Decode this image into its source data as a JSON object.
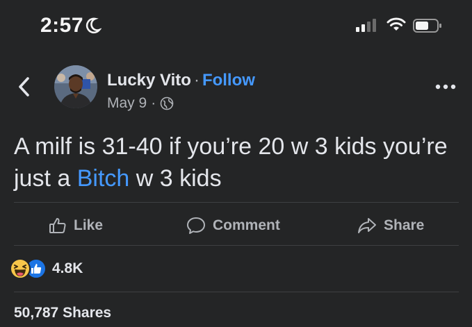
{
  "status_bar": {
    "time": "2:57",
    "icons": [
      "moon-icon",
      "signal-icon",
      "wifi-icon",
      "battery-icon"
    ]
  },
  "header": {
    "author": "Lucky Vito",
    "separator": "·",
    "follow_label": "Follow",
    "date": "May 9",
    "date_separator": "·",
    "privacy_icon": "globe-icon"
  },
  "post": {
    "text_before_link": "A milf is 31-40 if you’re 20 w 3 kids you’re just a ",
    "link_text": "Bitch",
    "text_after_link": " w 3 kids"
  },
  "actions": {
    "like_label": "Like",
    "comment_label": "Comment",
    "share_label": "Share"
  },
  "stats": {
    "reactions": [
      "haha-icon",
      "like-icon"
    ],
    "reaction_count": "4.8K",
    "shares": "50,787 Shares"
  },
  "colors": {
    "background": "#242526",
    "text": "#e4e6eb",
    "secondary": "#b0b3b8",
    "accent": "#4599ff",
    "divider": "#3e4042"
  }
}
